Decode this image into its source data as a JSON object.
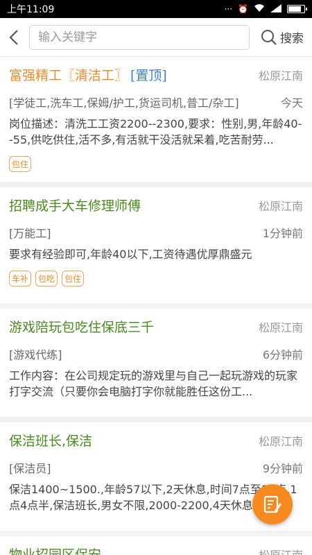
{
  "status_bar": {
    "time": "上午11:09"
  },
  "search": {
    "placeholder": "输入关键字",
    "button_label": "搜索"
  },
  "jobs": [
    {
      "title": "富强精工〖清洁工〗",
      "pin_label": "[置顶]",
      "location": "松原江南",
      "category": "[学徒工,洗车工,保姆/护工,货运司机,普工/杂工]",
      "time": "今天",
      "description": "岗位描述：清洗工工资2200--2300,要求：性别,男,年龄40--55,供吃供住,活不多,有活就干没活就呆着,吃苦耐劳...",
      "tags": [
        "包住"
      ]
    },
    {
      "title": "招聘成手大车修理师傅",
      "location": "松原江南",
      "category": "[万能工]",
      "time": "1分钟前",
      "description": "要求有经验即可,年龄40以下,工资待遇优厚鼎盛元",
      "tags": [
        "车补",
        "包吃",
        "包住"
      ]
    },
    {
      "title": "游戏陪玩包吃住保底三千",
      "location": "松原江南",
      "category": "[游戏代练]",
      "time": "6分钟前",
      "description": "工作内容：在公司规定玩的游戏里与自己一起玩游戏的玩家打字交流（只要你会电脑打字你就能胜任这份工...",
      "tags": []
    },
    {
      "title": "保洁班长,保洁",
      "location": "松原江南",
      "category": "[保洁员]",
      "time": "9分钟前",
      "description": "保洁1400~1500.,年龄57以下,2天休息,时间7点至11点,1点4点半,保洁班长,男女不限,2000-2200,4天休息",
      "tags": []
    },
    {
      "title": "物业招园区保安",
      "location": "松原江南",
      "category": "",
      "time": "",
      "description": "",
      "tags": []
    }
  ],
  "colors": {
    "accent_orange": "#f08a2c",
    "title_green": "#4b8a1f",
    "pin_blue": "#3b7fd6",
    "fab": "#f78a1e"
  },
  "icons": {
    "back": "back-arrow-icon",
    "search": "search-icon",
    "fab": "edit-note-icon"
  }
}
